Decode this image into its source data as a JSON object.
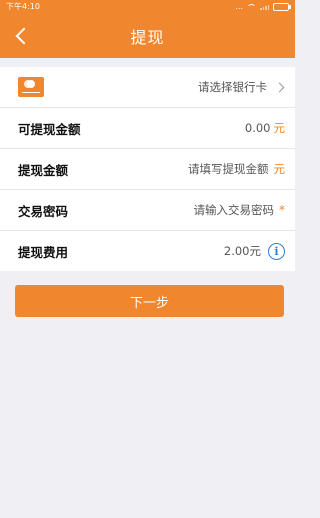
{
  "status_bar": {
    "time": "下午4:10",
    "dots": "..."
  },
  "header": {
    "title": "提现"
  },
  "bank_card": {
    "placeholder": "请选择银行卡"
  },
  "rows": {
    "available": {
      "label": "可提现金额",
      "value": "0.00",
      "unit": "元"
    },
    "amount": {
      "label": "提现金额",
      "placeholder": "请填写提现金额",
      "unit": "元"
    },
    "password": {
      "label": "交易密码",
      "placeholder": "请输入交易密码",
      "required": "*"
    },
    "fee": {
      "label": "提现费用",
      "value": "2.00元"
    }
  },
  "next_button": {
    "label": "下一步"
  },
  "icons": {
    "bank": "bank-card-icon",
    "info": "info-icon",
    "back": "back-arrow-icon"
  },
  "colors": {
    "accent": "#f0862e",
    "info": "#2f7fd6"
  }
}
